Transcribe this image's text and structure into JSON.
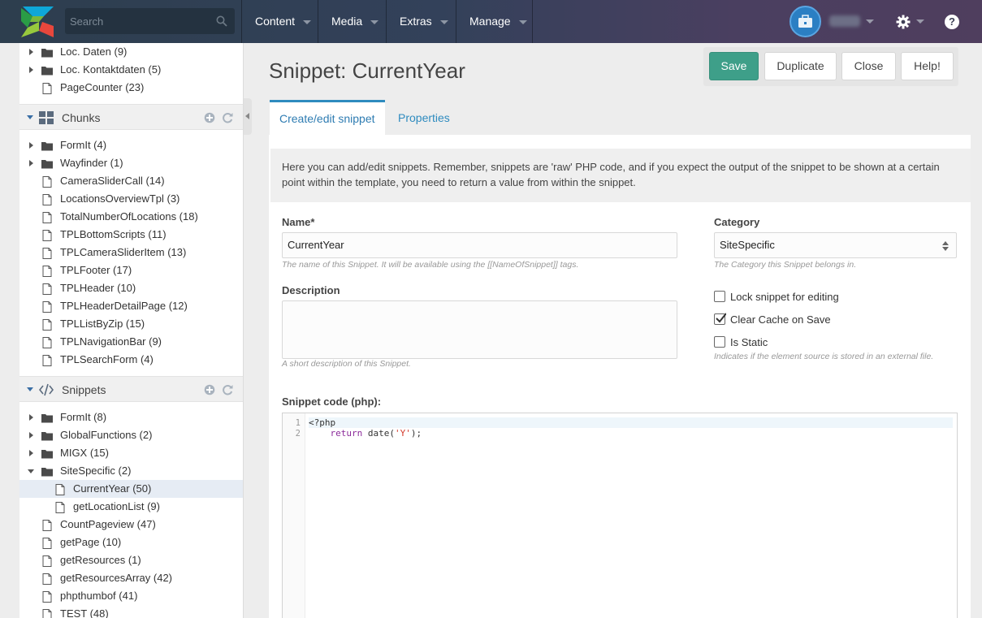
{
  "search": {
    "placeholder": "Search"
  },
  "topnav": [
    "Content",
    "Media",
    "Extras",
    "Manage"
  ],
  "help_label": "?",
  "tree": {
    "top_items": [
      {
        "type": "folder",
        "label": "Loc. Daten (9)"
      },
      {
        "type": "folder",
        "label": "Loc. Kontaktdaten (5)"
      },
      {
        "type": "file",
        "label": "PageCounter (23)"
      }
    ],
    "chunks": {
      "title": "Chunks",
      "items": [
        {
          "type": "folder",
          "label": "FormIt (4)"
        },
        {
          "type": "folder",
          "label": "Wayfinder (1)"
        },
        {
          "type": "file",
          "label": "CameraSliderCall (14)"
        },
        {
          "type": "file",
          "label": "LocationsOverviewTpl (3)"
        },
        {
          "type": "file",
          "label": "TotalNumberOfLocations (18)"
        },
        {
          "type": "file",
          "label": "TPLBottomScripts (11)"
        },
        {
          "type": "file",
          "label": "TPLCameraSliderItem (13)"
        },
        {
          "type": "file",
          "label": "TPLFooter (17)"
        },
        {
          "type": "file",
          "label": "TPLHeader (10)"
        },
        {
          "type": "file",
          "label": "TPLHeaderDetailPage (12)"
        },
        {
          "type": "file",
          "label": "TPLListByZip (15)"
        },
        {
          "type": "file",
          "label": "TPLNavigationBar (9)"
        },
        {
          "type": "file",
          "label": "TPLSearchForm (4)"
        }
      ]
    },
    "snippets": {
      "title": "Snippets",
      "items": [
        {
          "type": "folder",
          "label": "FormIt (8)"
        },
        {
          "type": "folder",
          "label": "GlobalFunctions (2)"
        },
        {
          "type": "folder",
          "label": "MIGX (15)"
        },
        {
          "type": "folder-open",
          "label": "SiteSpecific (2)"
        },
        {
          "type": "file-child",
          "label": "CurrentYear (50)",
          "selected": true
        },
        {
          "type": "file-child",
          "label": "getLocationList (9)"
        },
        {
          "type": "file",
          "label": "CountPageview (47)"
        },
        {
          "type": "file",
          "label": "getPage (10)"
        },
        {
          "type": "file",
          "label": "getResources (1)"
        },
        {
          "type": "file",
          "label": "getResourcesArray (42)"
        },
        {
          "type": "file",
          "label": "phpthumbof (41)"
        },
        {
          "type": "file",
          "label": "TEST (48)"
        }
      ]
    }
  },
  "page": {
    "title": "Snippet: CurrentYear",
    "actions": {
      "save": "Save",
      "duplicate": "Duplicate",
      "close": "Close",
      "help": "Help!"
    },
    "tabs": [
      "Create/edit snippet",
      "Properties"
    ],
    "intro": "Here you can add/edit snippets. Remember, snippets are 'raw' PHP code, and if you expect the output of the snippet to be shown at a certain point within the template, you need to return a value from within the snippet."
  },
  "form": {
    "name_label": "Name*",
    "name_value": "CurrentYear",
    "name_hint": "The name of this Snippet. It will be available using the [[NameOfSnippet]] tags.",
    "description_label": "Description",
    "description_value": "",
    "description_hint": "A short description of this Snippet.",
    "category_label": "Category",
    "category_value": "SiteSpecific",
    "category_hint": "The Category this Snippet belongs in.",
    "lock_label": "Lock snippet for editing",
    "lock_checked": false,
    "clear_cache_label": "Clear Cache on Save",
    "clear_cache_checked": true,
    "static_label": "Is Static",
    "static_checked": false,
    "static_hint": "Indicates if the element source is stored in an external file.",
    "code_label": "Snippet code (php):",
    "code": {
      "line1_num": "1",
      "line2_num": "2",
      "line1": "<?php",
      "line2_indent": "    ",
      "line2_kw": "return",
      "line2_mid": " date(",
      "line2_str": "'Y'",
      "line2_end": ");"
    }
  },
  "colors": {
    "primary": "#3e9f89",
    "link": "#2e8bbf",
    "selected_row": "#e6ecf4"
  }
}
